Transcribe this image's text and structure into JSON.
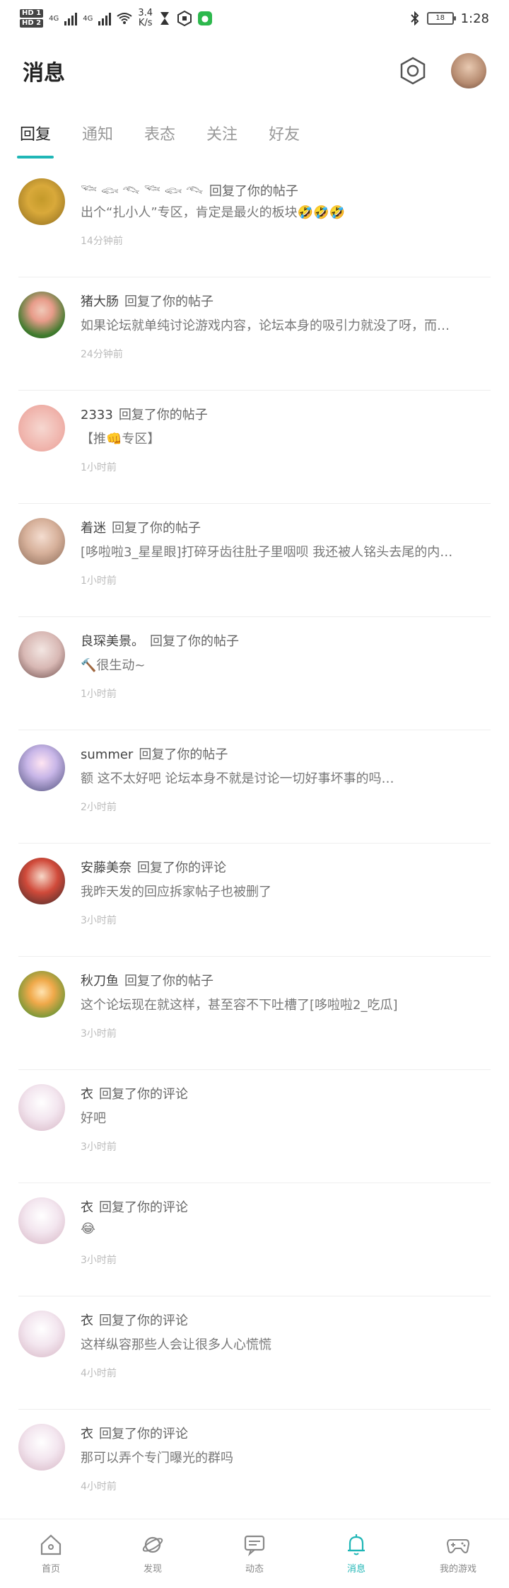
{
  "status_bar": {
    "hd1": "HD 1",
    "hd2": "HD 2",
    "net_type1": "4G",
    "net_type2": "4G",
    "speed": "3.4",
    "speed_unit": "K/s",
    "battery": "18",
    "time": "1:28"
  },
  "header": {
    "title": "消息"
  },
  "tabs": [
    {
      "label": "回复",
      "active": true
    },
    {
      "label": "通知",
      "active": false
    },
    {
      "label": "表态",
      "active": false
    },
    {
      "label": "关注",
      "active": false
    },
    {
      "label": "好友",
      "active": false
    }
  ],
  "items": [
    {
      "user": "𓆝 𓆟 𓆞 𓆝 𓆟 𓆞",
      "action": "回复了你的帖子",
      "content": "出个“扎小人”专区，肯定是最火的板块🤣🤣🤣",
      "time": "14分钟前"
    },
    {
      "user": "猪大肠",
      "action": "回复了你的帖子",
      "content": "如果论坛就单纯讨论游戏内容，论坛本身的吸引力就没了呀，而…",
      "time": "24分钟前"
    },
    {
      "user": "2333",
      "action": "回复了你的帖子",
      "content": "【推👊专区】",
      "time": "1小时前"
    },
    {
      "user": "着迷",
      "action": "回复了你的帖子",
      "content": "[哆啦啦3_星星眼]打碎牙齿往肚子里咽呗 我还被人铭头去尾的内…",
      "time": "1小时前"
    },
    {
      "user": "良琛美景。",
      "action": "回复了你的帖子",
      "content": "🔨很生动~",
      "time": "1小时前"
    },
    {
      "user": "summer",
      "action": "回复了你的帖子",
      "content": "额 这不太好吧 论坛本身不就是讨论一切好事坏事的吗…",
      "time": "2小时前"
    },
    {
      "user": "安藤美奈",
      "action": "回复了你的评论",
      "content": "我昨天发的回应拆家帖子也被删了",
      "time": "3小时前"
    },
    {
      "user": "秋刀鱼",
      "action": "回复了你的帖子",
      "content": "这个论坛现在就这样，甚至容不下吐槽了[哆啦啦2_吃瓜]",
      "time": "3小时前"
    },
    {
      "user": "衣",
      "action": "回复了你的评论",
      "content": "好吧",
      "time": "3小时前"
    },
    {
      "user": "衣",
      "action": "回复了你的评论",
      "content": "😂",
      "time": "3小时前"
    },
    {
      "user": "衣",
      "action": "回复了你的评论",
      "content": "这样纵容那些人会让很多人心慌慌",
      "time": "4小时前"
    },
    {
      "user": "衣",
      "action": "回复了你的评论",
      "content": "那可以弄个专门曝光的群吗",
      "time": "4小时前"
    }
  ],
  "bottom_nav": [
    {
      "label": "首页",
      "icon": "home-icon",
      "active": false
    },
    {
      "label": "发现",
      "icon": "planet-icon",
      "active": false
    },
    {
      "label": "动态",
      "icon": "chat-icon",
      "active": false
    },
    {
      "label": "消息",
      "icon": "bell-icon",
      "active": true
    },
    {
      "label": "我的游戏",
      "icon": "gamepad-icon",
      "active": false
    }
  ],
  "colors": {
    "accent": "#1fb6b6"
  }
}
